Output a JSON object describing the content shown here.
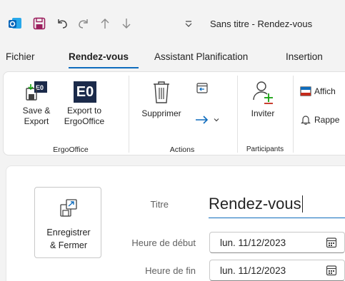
{
  "window": {
    "title": "Sans titre - Rendez-vous"
  },
  "colors": {
    "accent": "#0f6cbd",
    "outlook_blue": "#0364b8",
    "save_purple": "#9c1f5e",
    "invite_green": "#13a10e",
    "invite_red": "#c42b1c"
  },
  "menu": {
    "tabs": [
      "Fichier",
      "Rendez-vous",
      "Assistant Planification",
      "Insertion"
    ],
    "active_tab": "Rendez-vous"
  },
  "ribbon": {
    "ergooffice": {
      "save_export_line1": "Save &",
      "save_export_line2": "Export",
      "export_to_line1": "Export to",
      "export_to_line2": "ErgoOffice",
      "logo_text": "E0",
      "group_label": "ErgoOffice"
    },
    "actions": {
      "delete_label": "Supprimer",
      "group_label": "Actions"
    },
    "participants": {
      "invite_label": "Inviter",
      "group_label": "Participants"
    },
    "options": {
      "show_as_label": "Affich",
      "reminder_label": "Rappe"
    }
  },
  "form": {
    "save_close_line1": "Enregistrer",
    "save_close_line2": "& Fermer",
    "title_label": "Titre",
    "title_value": "Rendez-vous",
    "start_label": "Heure de début",
    "start_date": "lun. 11/12/2023",
    "end_label": "Heure de fin",
    "end_date": "lun. 11/12/2023"
  },
  "icons": {
    "app": "outlook-icon",
    "save": "save-icon",
    "undo": "undo-icon",
    "redo": "redo-icon",
    "up": "arrow-up-icon",
    "down": "arrow-down-icon",
    "customize": "customize-toolbar-icon",
    "delete": "trash-icon",
    "calendar_forward": "calendar-forward-icon",
    "forward": "forward-arrow-icon",
    "invite": "add-person-icon",
    "bell": "bell-icon",
    "calendar": "calendar-icon"
  }
}
